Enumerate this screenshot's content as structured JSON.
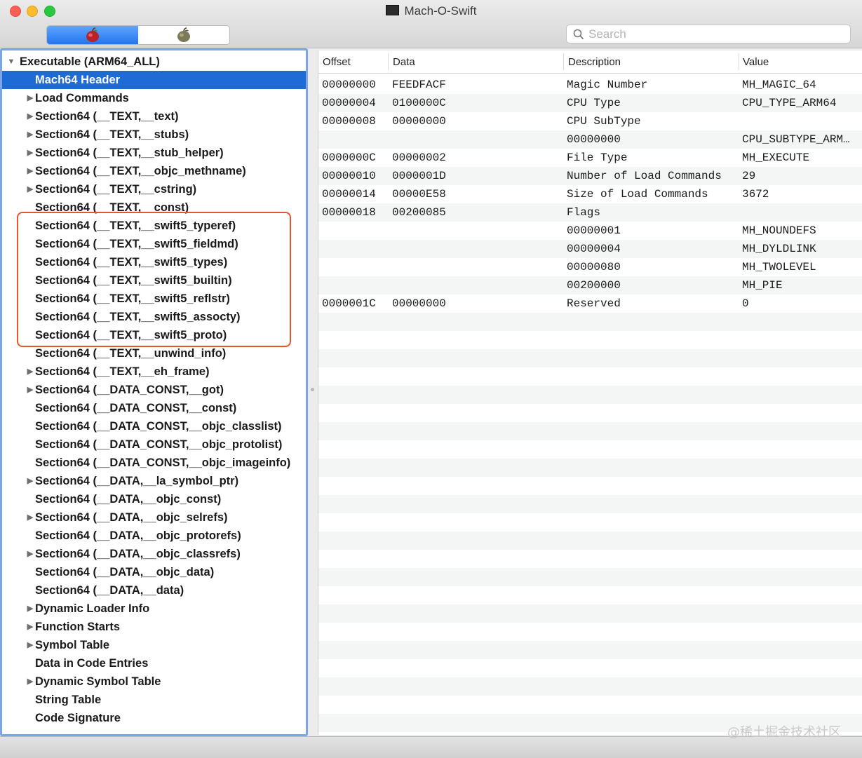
{
  "window": {
    "title": "Mach-O-Swift"
  },
  "toolbar": {
    "segments": [
      {
        "name": "raw-view-icon",
        "active": true
      },
      {
        "name": "rva-view-icon",
        "active": false
      }
    ],
    "search": {
      "placeholder": "Search",
      "value": ""
    }
  },
  "tree": {
    "root": "Executable  (ARM64_ALL)",
    "items": [
      {
        "label": "Mach64 Header",
        "expandable": false,
        "selected": true
      },
      {
        "label": "Load Commands",
        "expandable": true
      },
      {
        "label": "Section64 (__TEXT,__text)",
        "expandable": true
      },
      {
        "label": "Section64 (__TEXT,__stubs)",
        "expandable": true
      },
      {
        "label": "Section64 (__TEXT,__stub_helper)",
        "expandable": true
      },
      {
        "label": "Section64 (__TEXT,__objc_methname)",
        "expandable": true
      },
      {
        "label": "Section64 (__TEXT,__cstring)",
        "expandable": true
      },
      {
        "label": "Section64 (__TEXT,__const)",
        "expandable": false
      },
      {
        "label": "Section64 (__TEXT,__swift5_typeref)",
        "expandable": false
      },
      {
        "label": "Section64 (__TEXT,__swift5_fieldmd)",
        "expandable": false
      },
      {
        "label": "Section64 (__TEXT,__swift5_types)",
        "expandable": false
      },
      {
        "label": "Section64 (__TEXT,__swift5_builtin)",
        "expandable": false
      },
      {
        "label": "Section64 (__TEXT,__swift5_reflstr)",
        "expandable": false
      },
      {
        "label": "Section64 (__TEXT,__swift5_assocty)",
        "expandable": false
      },
      {
        "label": "Section64 (__TEXT,__swift5_proto)",
        "expandable": false
      },
      {
        "label": "Section64 (__TEXT,__unwind_info)",
        "expandable": false
      },
      {
        "label": "Section64 (__TEXT,__eh_frame)",
        "expandable": true
      },
      {
        "label": "Section64 (__DATA_CONST,__got)",
        "expandable": true
      },
      {
        "label": "Section64 (__DATA_CONST,__const)",
        "expandable": false
      },
      {
        "label": "Section64 (__DATA_CONST,__objc_classlist)",
        "expandable": false
      },
      {
        "label": "Section64 (__DATA_CONST,__objc_protolist)",
        "expandable": false
      },
      {
        "label": "Section64 (__DATA_CONST,__objc_imageinfo)",
        "expandable": false
      },
      {
        "label": "Section64 (__DATA,__la_symbol_ptr)",
        "expandable": true
      },
      {
        "label": "Section64 (__DATA,__objc_const)",
        "expandable": false
      },
      {
        "label": "Section64 (__DATA,__objc_selrefs)",
        "expandable": true
      },
      {
        "label": "Section64 (__DATA,__objc_protorefs)",
        "expandable": false
      },
      {
        "label": "Section64 (__DATA,__objc_classrefs)",
        "expandable": true
      },
      {
        "label": "Section64 (__DATA,__objc_data)",
        "expandable": false
      },
      {
        "label": "Section64 (__DATA,__data)",
        "expandable": false
      },
      {
        "label": "Dynamic Loader Info",
        "expandable": true
      },
      {
        "label": "Function Starts",
        "expandable": true
      },
      {
        "label": "Symbol Table",
        "expandable": true
      },
      {
        "label": "Data in Code Entries",
        "expandable": false
      },
      {
        "label": "Dynamic Symbol Table",
        "expandable": true
      },
      {
        "label": "String Table",
        "expandable": false
      },
      {
        "label": "Code Signature",
        "expandable": false
      }
    ]
  },
  "table": {
    "headers": {
      "offset": "Offset",
      "data": "Data",
      "description": "Description",
      "value": "Value"
    },
    "rows": [
      {
        "offset": "00000000",
        "data": "FEEDFACF",
        "description": "Magic Number",
        "value": "MH_MAGIC_64"
      },
      {
        "offset": "00000004",
        "data": "0100000C",
        "description": "CPU Type",
        "value": "CPU_TYPE_ARM64"
      },
      {
        "offset": "00000008",
        "data": "00000000",
        "description": "CPU SubType",
        "value": ""
      },
      {
        "offset": "",
        "data": "",
        "description": "00000000",
        "value": "CPU_SUBTYPE_ARM…"
      },
      {
        "offset": "0000000C",
        "data": "00000002",
        "description": "File Type",
        "value": "MH_EXECUTE"
      },
      {
        "offset": "00000010",
        "data": "0000001D",
        "description": "Number of Load Commands",
        "value": "29"
      },
      {
        "offset": "00000014",
        "data": "00000E58",
        "description": "Size of Load Commands",
        "value": "3672"
      },
      {
        "offset": "00000018",
        "data": "00200085",
        "description": "Flags",
        "value": ""
      },
      {
        "offset": "",
        "data": "",
        "description": "00000001",
        "value": "MH_NOUNDEFS"
      },
      {
        "offset": "",
        "data": "",
        "description": "00000004",
        "value": "MH_DYLDLINK"
      },
      {
        "offset": "",
        "data": "",
        "description": "00000080",
        "value": "MH_TWOLEVEL"
      },
      {
        "offset": "",
        "data": "",
        "description": "00200000",
        "value": "MH_PIE"
      },
      {
        "offset": "0000001C",
        "data": "00000000",
        "description": "Reserved",
        "value": "0"
      }
    ]
  },
  "watermark": "@稀土掘金技术社区",
  "colors": {
    "selection": "#1e6bd6",
    "highlight_box": "#e4572e",
    "stripe": "#f4f5f5"
  }
}
